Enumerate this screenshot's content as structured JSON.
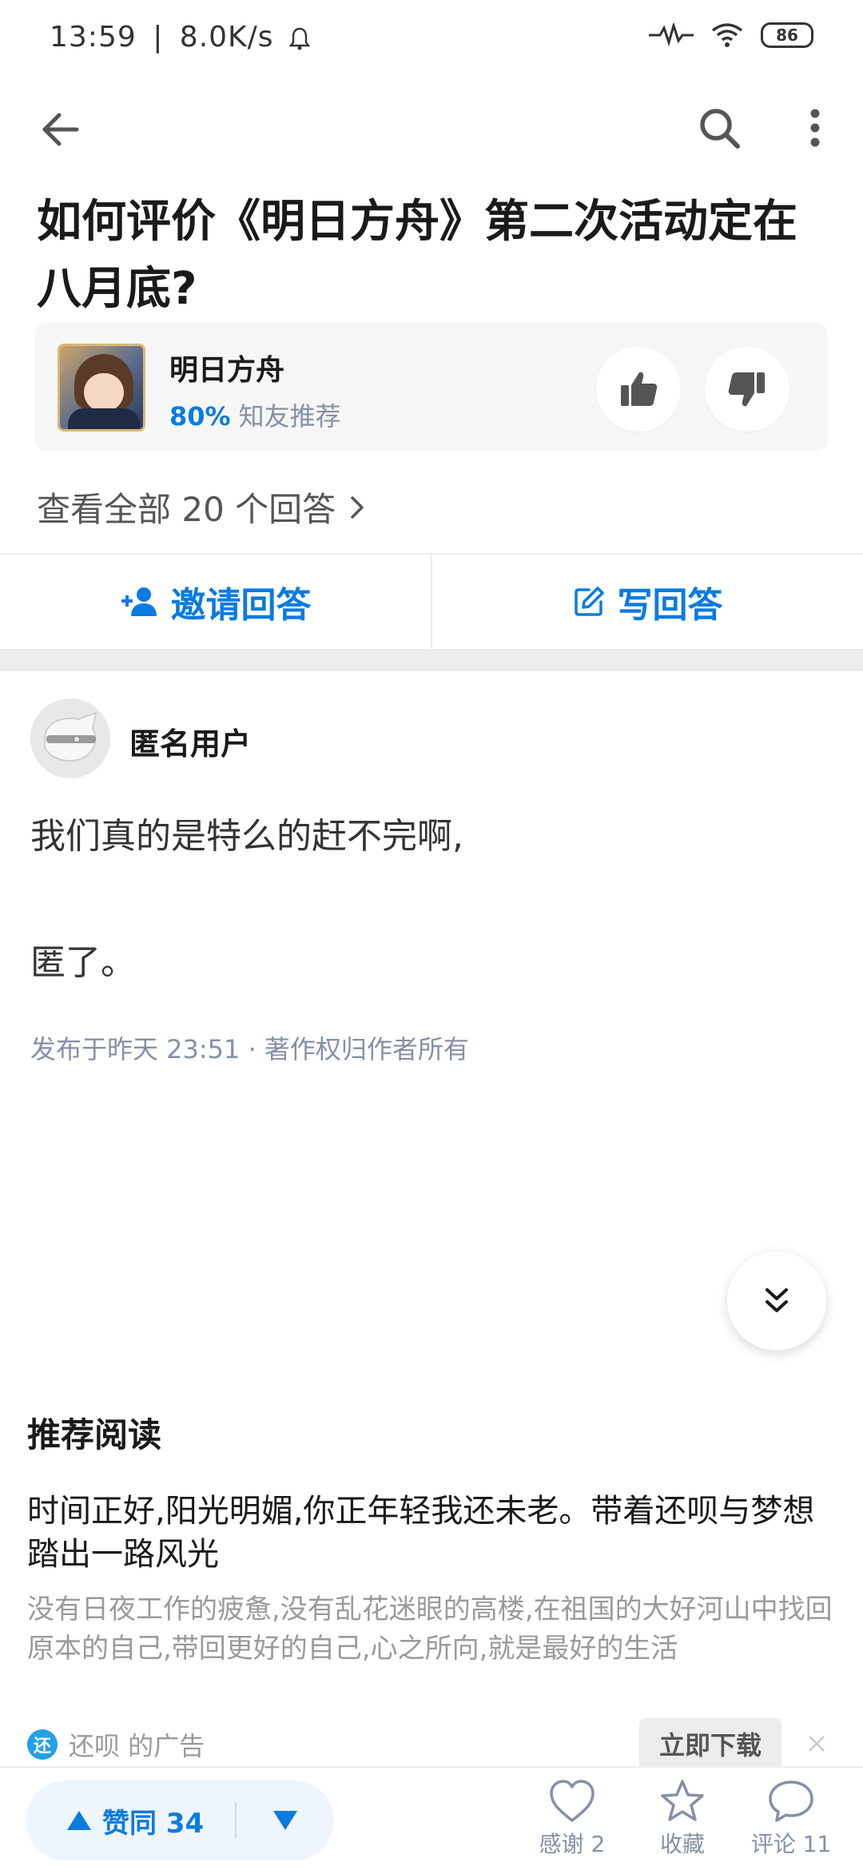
{
  "status_bar": {
    "time": "13:59",
    "separator": "|",
    "net_speed": "8.0K/s",
    "battery": "86"
  },
  "question": {
    "title": "如何评价《明日方舟》第二次活动定在八月底?"
  },
  "game_card": {
    "name": "明日方舟",
    "percent": "80%",
    "rec_text": "知友推荐"
  },
  "all_answers": {
    "label": "查看全部 20 个回答"
  },
  "actions": {
    "invite": "邀请回答",
    "write": "写回答"
  },
  "answer": {
    "author": "匿名用户",
    "paragraphs": [
      "我们真的是特么的赶不完啊,",
      "匿了。"
    ],
    "meta": "发布于昨天 23:51 · 著作权归作者所有"
  },
  "recommend": {
    "heading": "推荐阅读",
    "ad_title": "时间正好,阳光明媚,你正年轻我还未老。带着还呗与梦想踏出一路风光",
    "ad_desc": "没有日夜工作的疲惫,没有乱花迷眼的高楼,在祖国的大好河山中找回原本的自己,带回更好的自己,心之所向,就是最好的生活",
    "sponsor_logo": "还",
    "sponsor": "还呗 的广告",
    "download": "立即下载"
  },
  "bottom_bar": {
    "upvote": "赞同 34",
    "thanks": "感谢 2",
    "favorite": "收藏",
    "comment": "评论 11"
  },
  "colors": {
    "accent": "#0a7be0",
    "muted": "#8590a6"
  },
  "icons": [
    "back-icon",
    "search-icon",
    "more-icon",
    "thumb-up-icon",
    "thumb-down-icon",
    "chevron-right-icon",
    "add-person-icon",
    "edit-icon",
    "double-chevron-down-icon",
    "close-icon",
    "triangle-up-icon",
    "triangle-down-icon",
    "heart-icon",
    "star-icon",
    "comment-icon"
  ]
}
